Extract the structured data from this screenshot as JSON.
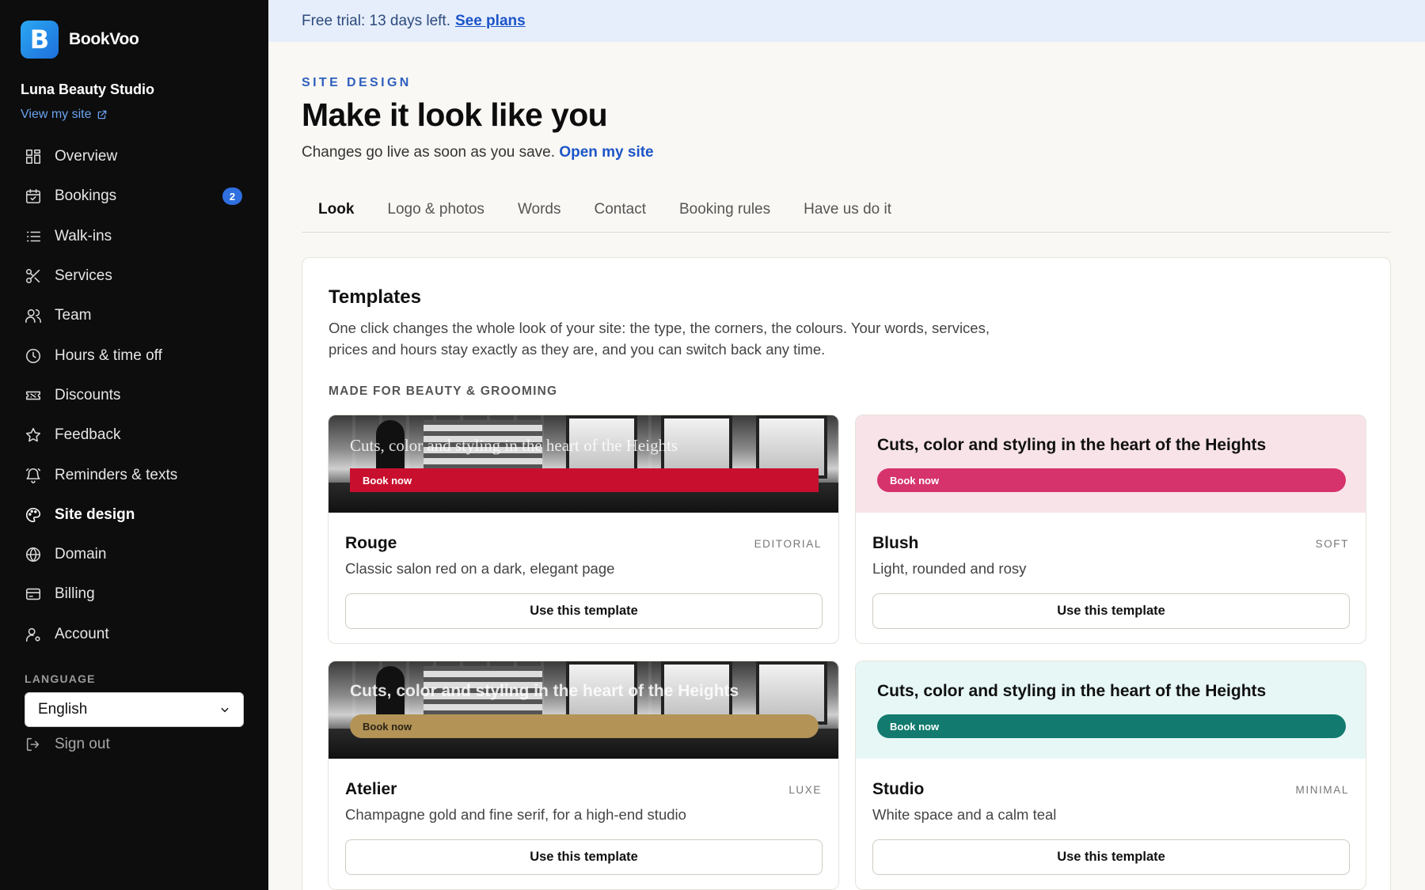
{
  "brand": {
    "logo_letter": "B",
    "name": "BookVoo"
  },
  "studio": {
    "name": "Luna Beauty Studio",
    "view_site": "View my site"
  },
  "sidebar": {
    "items": [
      {
        "label": "Overview",
        "icon": "grid-icon"
      },
      {
        "label": "Bookings",
        "icon": "calendar-icon",
        "badge": "2"
      },
      {
        "label": "Walk-ins",
        "icon": "list-icon"
      },
      {
        "label": "Services",
        "icon": "scissors-icon"
      },
      {
        "label": "Team",
        "icon": "users-icon"
      },
      {
        "label": "Hours & time off",
        "icon": "clock-icon"
      },
      {
        "label": "Discounts",
        "icon": "ticket-icon"
      },
      {
        "label": "Feedback",
        "icon": "star-icon"
      },
      {
        "label": "Reminders & texts",
        "icon": "bell-icon"
      },
      {
        "label": "Site design",
        "icon": "palette-icon",
        "active": true
      },
      {
        "label": "Domain",
        "icon": "globe-icon"
      },
      {
        "label": "Billing",
        "icon": "card-icon"
      },
      {
        "label": "Account",
        "icon": "user-gear-icon"
      }
    ],
    "language_label": "LANGUAGE",
    "language_value": "English",
    "sign_out": "Sign out"
  },
  "banner": {
    "text": "Free trial: 13 days left.",
    "link": "See plans"
  },
  "page": {
    "eyebrow": "SITE DESIGN",
    "title": "Make it look like you",
    "subtitle": "Changes go live as soon as you save.",
    "subtitle_link": "Open my site"
  },
  "tabs": [
    "Look",
    "Logo & photos",
    "Words",
    "Contact",
    "Booking rules",
    "Have us do it"
  ],
  "templates_card": {
    "title": "Templates",
    "description": "One click changes the whole look of your site: the type, the corners, the colours. Your words, services, prices and hours stay exactly as they are, and you can switch back any time.",
    "section_label": "MADE FOR BEAUTY & GROOMING",
    "preview_headline": "Cuts, color and styling in the heart of the Heights",
    "book_now": "Book now",
    "use_button": "Use this template",
    "templates": [
      {
        "name": "Rouge",
        "kind": "EDITORIAL",
        "desc": "Classic salon red on a dark, elegant page",
        "accent": "#c8102e"
      },
      {
        "name": "Blush",
        "kind": "SOFT",
        "desc": "Light, rounded and rosy",
        "accent": "#d6336c"
      },
      {
        "name": "Atelier",
        "kind": "LUXE",
        "desc": "Champagne gold and fine serif, for a high-end studio",
        "accent": "#b39356"
      },
      {
        "name": "Studio",
        "kind": "MINIMAL",
        "desc": "White space and a calm teal",
        "accent": "#127a6e"
      }
    ]
  }
}
